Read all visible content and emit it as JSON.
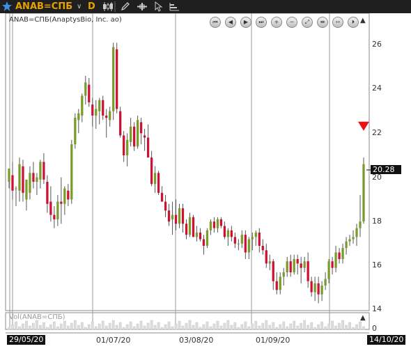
{
  "toolbar": {
    "ticker": "ANAB=СПБ",
    "period": "D",
    "icons": [
      "star-icon",
      "chevron-down-icon",
      "candlestick-icon",
      "pencil-icon",
      "crosshair-icon",
      "cursor-icon",
      "bars-icon"
    ]
  },
  "chart": {
    "instrument_label": "ANAB=СПБ(AnaptysBio, Inc. ao)",
    "volume_label": "Vol(ANAB=СПБ)",
    "nav_buttons": [
      "⏮",
      "◀",
      "▶",
      "⏭",
      "+",
      "−",
      "⤢",
      "⇹",
      "⇿",
      "⏵"
    ],
    "y_ticks": [
      "26",
      "24",
      "22",
      "20",
      "18",
      "16",
      "14"
    ],
    "volume_tick": "0",
    "last_price": "20.28",
    "x_labels": [
      "29/05/20",
      "01/07/20",
      "03/08/20",
      "01/09/20",
      "14/10/20"
    ],
    "colors": {
      "up": "#7a9a2a",
      "down": "#cc1133",
      "marker": "#ee1111"
    }
  },
  "chart_data": {
    "type": "candlestick",
    "ylim": [
      13.5,
      26.8
    ],
    "candles": [
      [
        19.5,
        20.0,
        19.2,
        20.1
      ],
      [
        19.8,
        20.4,
        18.7,
        19.1
      ],
      [
        19.2,
        19.3,
        18.4,
        19.2
      ],
      [
        19.1,
        20.6,
        18.6,
        20.3
      ],
      [
        20.2,
        20.5,
        18.6,
        19.0
      ],
      [
        18.7,
        19.4,
        18.2,
        19.6
      ],
      [
        19.0,
        20.2,
        18.7,
        19.9
      ],
      [
        19.9,
        20.4,
        19.2,
        19.5
      ],
      [
        19.5,
        19.9,
        18.9,
        19.7
      ],
      [
        19.6,
        20.5,
        19.2,
        20.4
      ],
      [
        20.4,
        20.8,
        19.4,
        19.6
      ],
      [
        19.5,
        19.8,
        18.1,
        18.5
      ],
      [
        18.6,
        19.3,
        17.7,
        18.0
      ],
      [
        18.0,
        18.4,
        17.4,
        17.8
      ],
      [
        17.8,
        18.9,
        17.5,
        18.6
      ],
      [
        18.6,
        19.7,
        17.6,
        18.5
      ],
      [
        18.5,
        19.3,
        18.0,
        19.2
      ],
      [
        19.1,
        19.4,
        18.4,
        18.7
      ],
      [
        18.7,
        21.4,
        18.5,
        21.2
      ],
      [
        21.2,
        22.6,
        21.0,
        22.4
      ],
      [
        22.3,
        22.8,
        21.7,
        22.6
      ],
      [
        22.5,
        23.5,
        22.2,
        23.4
      ],
      [
        23.4,
        24.3,
        23.0,
        24.0
      ],
      [
        23.9,
        24.2,
        22.9,
        23.1
      ],
      [
        23.0,
        23.3,
        22.0,
        22.5
      ],
      [
        22.5,
        23.2,
        21.9,
        22.8
      ],
      [
        22.7,
        23.3,
        22.1,
        23.2
      ],
      [
        23.2,
        23.4,
        22.3,
        22.5
      ],
      [
        22.5,
        22.8,
        21.5,
        22.4
      ],
      [
        22.3,
        22.9,
        22.0,
        22.7
      ],
      [
        22.7,
        25.8,
        22.3,
        25.6
      ],
      [
        25.5,
        25.8,
        22.6,
        22.8
      ],
      [
        22.7,
        22.9,
        21.5,
        21.6
      ],
      [
        21.6,
        21.8,
        20.4,
        20.7
      ],
      [
        20.7,
        21.7,
        20.2,
        21.4
      ],
      [
        21.3,
        22.4,
        21.1,
        22.0
      ],
      [
        22.0,
        22.2,
        20.9,
        21.1
      ],
      [
        21.1,
        22.5,
        21.0,
        22.3
      ],
      [
        22.2,
        22.4,
        21.2,
        21.7
      ],
      [
        21.6,
        21.9,
        20.9,
        21.5
      ],
      [
        21.5,
        22.1,
        20.6,
        20.6
      ],
      [
        20.6,
        20.9,
        19.3,
        19.4
      ],
      [
        19.4,
        20.2,
        19.0,
        19.9
      ],
      [
        19.9,
        20.0,
        18.9,
        19.0
      ],
      [
        19.0,
        19.3,
        18.6,
        18.6
      ],
      [
        18.6,
        18.9,
        17.9,
        18.2
      ],
      [
        18.2,
        18.5,
        17.5,
        17.7
      ],
      [
        17.8,
        18.6,
        17.1,
        18.0
      ],
      [
        18.0,
        18.7,
        17.3,
        17.6
      ],
      [
        17.6,
        18.5,
        17.4,
        18.3
      ],
      [
        18.3,
        18.5,
        17.2,
        17.6
      ],
      [
        17.6,
        17.8,
        16.9,
        17.1
      ],
      [
        17.1,
        18.1,
        17.0,
        17.9
      ],
      [
        17.9,
        18.0,
        17.0,
        17.0
      ],
      [
        17.0,
        17.5,
        16.8,
        17.2
      ],
      [
        17.2,
        17.4,
        16.8,
        16.9
      ],
      [
        16.9,
        17.1,
        16.2,
        16.6
      ],
      [
        16.6,
        17.4,
        16.5,
        17.3
      ],
      [
        17.3,
        17.8,
        17.1,
        17.7
      ],
      [
        17.7,
        17.9,
        17.2,
        17.4
      ],
      [
        17.4,
        17.9,
        17.2,
        17.8
      ],
      [
        17.8,
        17.9,
        17.4,
        17.5
      ],
      [
        17.5,
        17.7,
        16.9,
        17.0
      ],
      [
        17.0,
        17.4,
        16.6,
        17.3
      ],
      [
        17.3,
        17.5,
        16.8,
        17.0
      ],
      [
        17.0,
        17.2,
        16.5,
        16.7
      ],
      [
        16.7,
        16.9,
        16.4,
        16.7
      ],
      [
        16.7,
        17.3,
        16.5,
        17.1
      ],
      [
        17.1,
        17.3,
        16.0,
        16.3
      ],
      [
        16.3,
        17.0,
        16.0,
        16.9
      ],
      [
        16.9,
        17.2,
        16.4,
        17.0
      ],
      [
        17.0,
        17.3,
        16.6,
        17.2
      ],
      [
        17.2,
        17.4,
        16.3,
        16.6
      ],
      [
        16.6,
        16.9,
        16.2,
        16.4
      ],
      [
        16.4,
        16.7,
        15.6,
        15.8
      ],
      [
        15.8,
        16.2,
        15.5,
        15.9
      ],
      [
        15.9,
        16.0,
        14.6,
        15.0
      ],
      [
        15.0,
        15.4,
        14.4,
        14.6
      ],
      [
        14.6,
        15.4,
        14.4,
        15.2
      ],
      [
        15.2,
        15.6,
        14.8,
        15.4
      ],
      [
        15.4,
        16.1,
        15.2,
        15.9
      ],
      [
        15.9,
        16.2,
        15.2,
        15.4
      ],
      [
        15.4,
        16.2,
        15.3,
        16.0
      ],
      [
        16.0,
        16.2,
        15.3,
        15.8
      ],
      [
        15.8,
        16.1,
        14.9,
        15.6
      ],
      [
        15.6,
        16.1,
        15.4,
        15.9
      ],
      [
        15.9,
        16.3,
        14.7,
        15.0
      ],
      [
        15.0,
        15.2,
        14.3,
        14.5
      ],
      [
        14.5,
        15.2,
        14.1,
        14.9
      ],
      [
        14.9,
        15.2,
        14.0,
        14.4
      ],
      [
        14.4,
        15.0,
        14.1,
        14.8
      ],
      [
        14.8,
        15.4,
        14.6,
        15.1
      ],
      [
        15.1,
        16.0,
        14.9,
        15.9
      ],
      [
        15.9,
        16.1,
        15.3,
        15.6
      ],
      [
        15.6,
        16.6,
        15.4,
        16.3
      ],
      [
        16.3,
        16.5,
        15.8,
        16.0
      ],
      [
        16.0,
        16.7,
        15.8,
        16.5
      ],
      [
        16.5,
        17.0,
        16.2,
        16.8
      ],
      [
        16.8,
        17.1,
        16.6,
        16.9
      ],
      [
        16.9,
        17.3,
        16.7,
        17.0
      ],
      [
        17.0,
        17.6,
        16.6,
        17.4
      ],
      [
        17.4,
        18.9,
        17.0,
        17.7
      ],
      [
        17.7,
        20.6,
        17.6,
        20.3
      ]
    ],
    "marker_price": 22.0,
    "volume_ylim": [
      0,
      1
    ]
  }
}
